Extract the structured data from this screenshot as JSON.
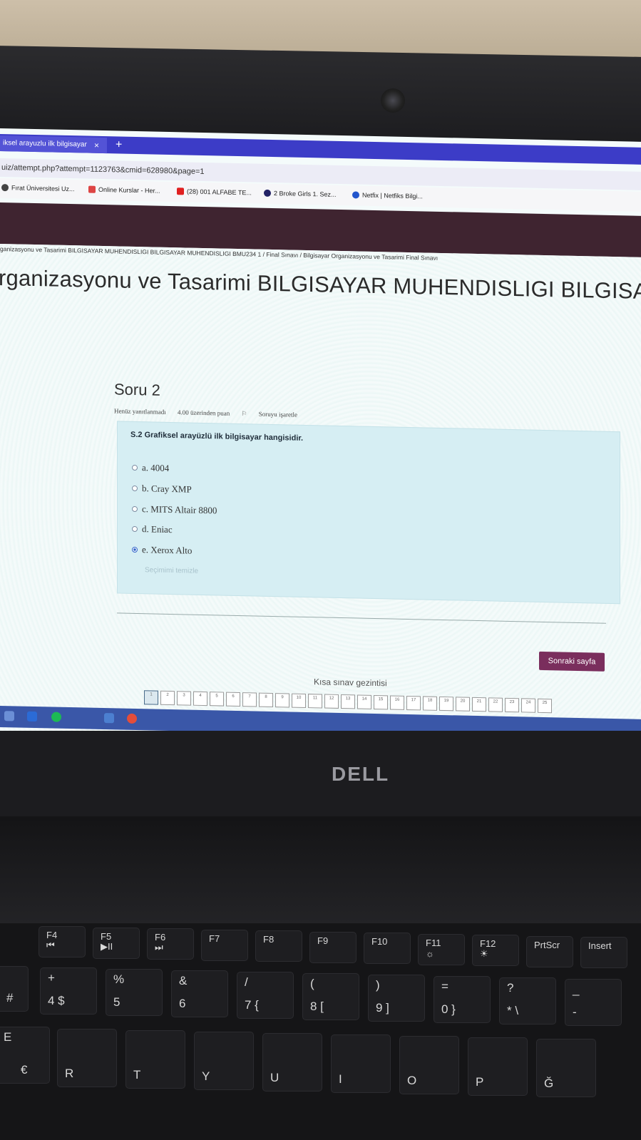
{
  "browser": {
    "tab_title": "iksel arayuzlu ilk bilgisayar",
    "tab_close": "×",
    "tab_add": "+",
    "url": "uiz/attempt.php?attempt=1123763&cmid=628980&page=1",
    "bookmarks": [
      {
        "label": "Fırat Üniversitesi Uz...",
        "color": "#444444"
      },
      {
        "label": "Online Kurslar - Her...",
        "color": "#d44"
      },
      {
        "label": "(28) 001 ALFABE TE...",
        "color": "#e02020"
      },
      {
        "label": "2 Broke Girls 1. Sez...",
        "color": "#222266"
      },
      {
        "label": "Netfix | Netfiks Bilgi...",
        "color": "#2255cc"
      }
    ]
  },
  "page": {
    "breadcrumb": "ganizasyonu ve Tasarimi BILGISAYAR MUHENDISLIGI BILGISAYAR MUHENDISLIGI BMU234 1  /  Final Sınavı  /  Bilgisayar Organizasyonu ve Tasarimi Final Sınavı",
    "title": "rganizasyonu ve Tasarimi BILGISAYAR MUHENDISLIGI BILGISA"
  },
  "question": {
    "heading": "Soru 2",
    "status": "Henüz yanıtlanmadı",
    "points": "4.00 üzerinden puan",
    "flag_label": "Soruyu işaretle",
    "text": "S.2 Grafiksel arayüzlü ilk bilgisayar hangisidir.",
    "options": [
      {
        "label": "a. 4004",
        "selected": false
      },
      {
        "label": "b. Cray XMP",
        "selected": false
      },
      {
        "label": "c. MITS Altair 8800",
        "selected": false
      },
      {
        "label": "d. Eniac",
        "selected": false
      },
      {
        "label": "e. Xerox Alto",
        "selected": true
      }
    ],
    "clear_choice": "Seçimimi temizle"
  },
  "navigation": {
    "next_button": "Sonraki sayfa",
    "title": "Kısa sınav gezintisi",
    "pages": [
      "1",
      "2",
      "3",
      "4",
      "5",
      "6",
      "7",
      "8",
      "9",
      "10",
      "11",
      "12",
      "13",
      "14",
      "15",
      "16",
      "17",
      "18",
      "19",
      "20",
      "21",
      "22",
      "23",
      "24",
      "25"
    ],
    "current_page": "1"
  },
  "laptop": {
    "brand": "DELL",
    "keys_function": [
      {
        "main": "F4",
        "sub": "⏮"
      },
      {
        "main": "F5",
        "sub": "▶II"
      },
      {
        "main": "F6",
        "sub": "⏭"
      },
      {
        "main": "F7",
        "sub": ""
      },
      {
        "main": "F8",
        "sub": ""
      },
      {
        "main": "F9",
        "sub": ""
      },
      {
        "main": "F10",
        "sub": ""
      },
      {
        "main": "F11",
        "sub": "☼"
      },
      {
        "main": "F12",
        "sub": "☀"
      },
      {
        "main": "PrtScr",
        "sub": ""
      },
      {
        "main": "Insert",
        "sub": ""
      }
    ],
    "keys_number": [
      {
        "top": "+",
        "main": "4  $"
      },
      {
        "top": "%",
        "main": "5"
      },
      {
        "top": "&",
        "main": "6"
      },
      {
        "top": "/",
        "main": "7  {"
      },
      {
        "top": "(",
        "main": "8  ["
      },
      {
        "top": ")",
        "main": "9  ]"
      },
      {
        "top": "=",
        "main": "0  }"
      },
      {
        "top": "?",
        "main": "*  \\"
      },
      {
        "top": "_",
        "main": "-"
      }
    ],
    "keys_letter": [
      "R",
      "T",
      "Y",
      "U",
      "I",
      "O",
      "P",
      "Ğ"
    ],
    "key_e": "E",
    "key_euro": "€",
    "key_hash": "#"
  }
}
